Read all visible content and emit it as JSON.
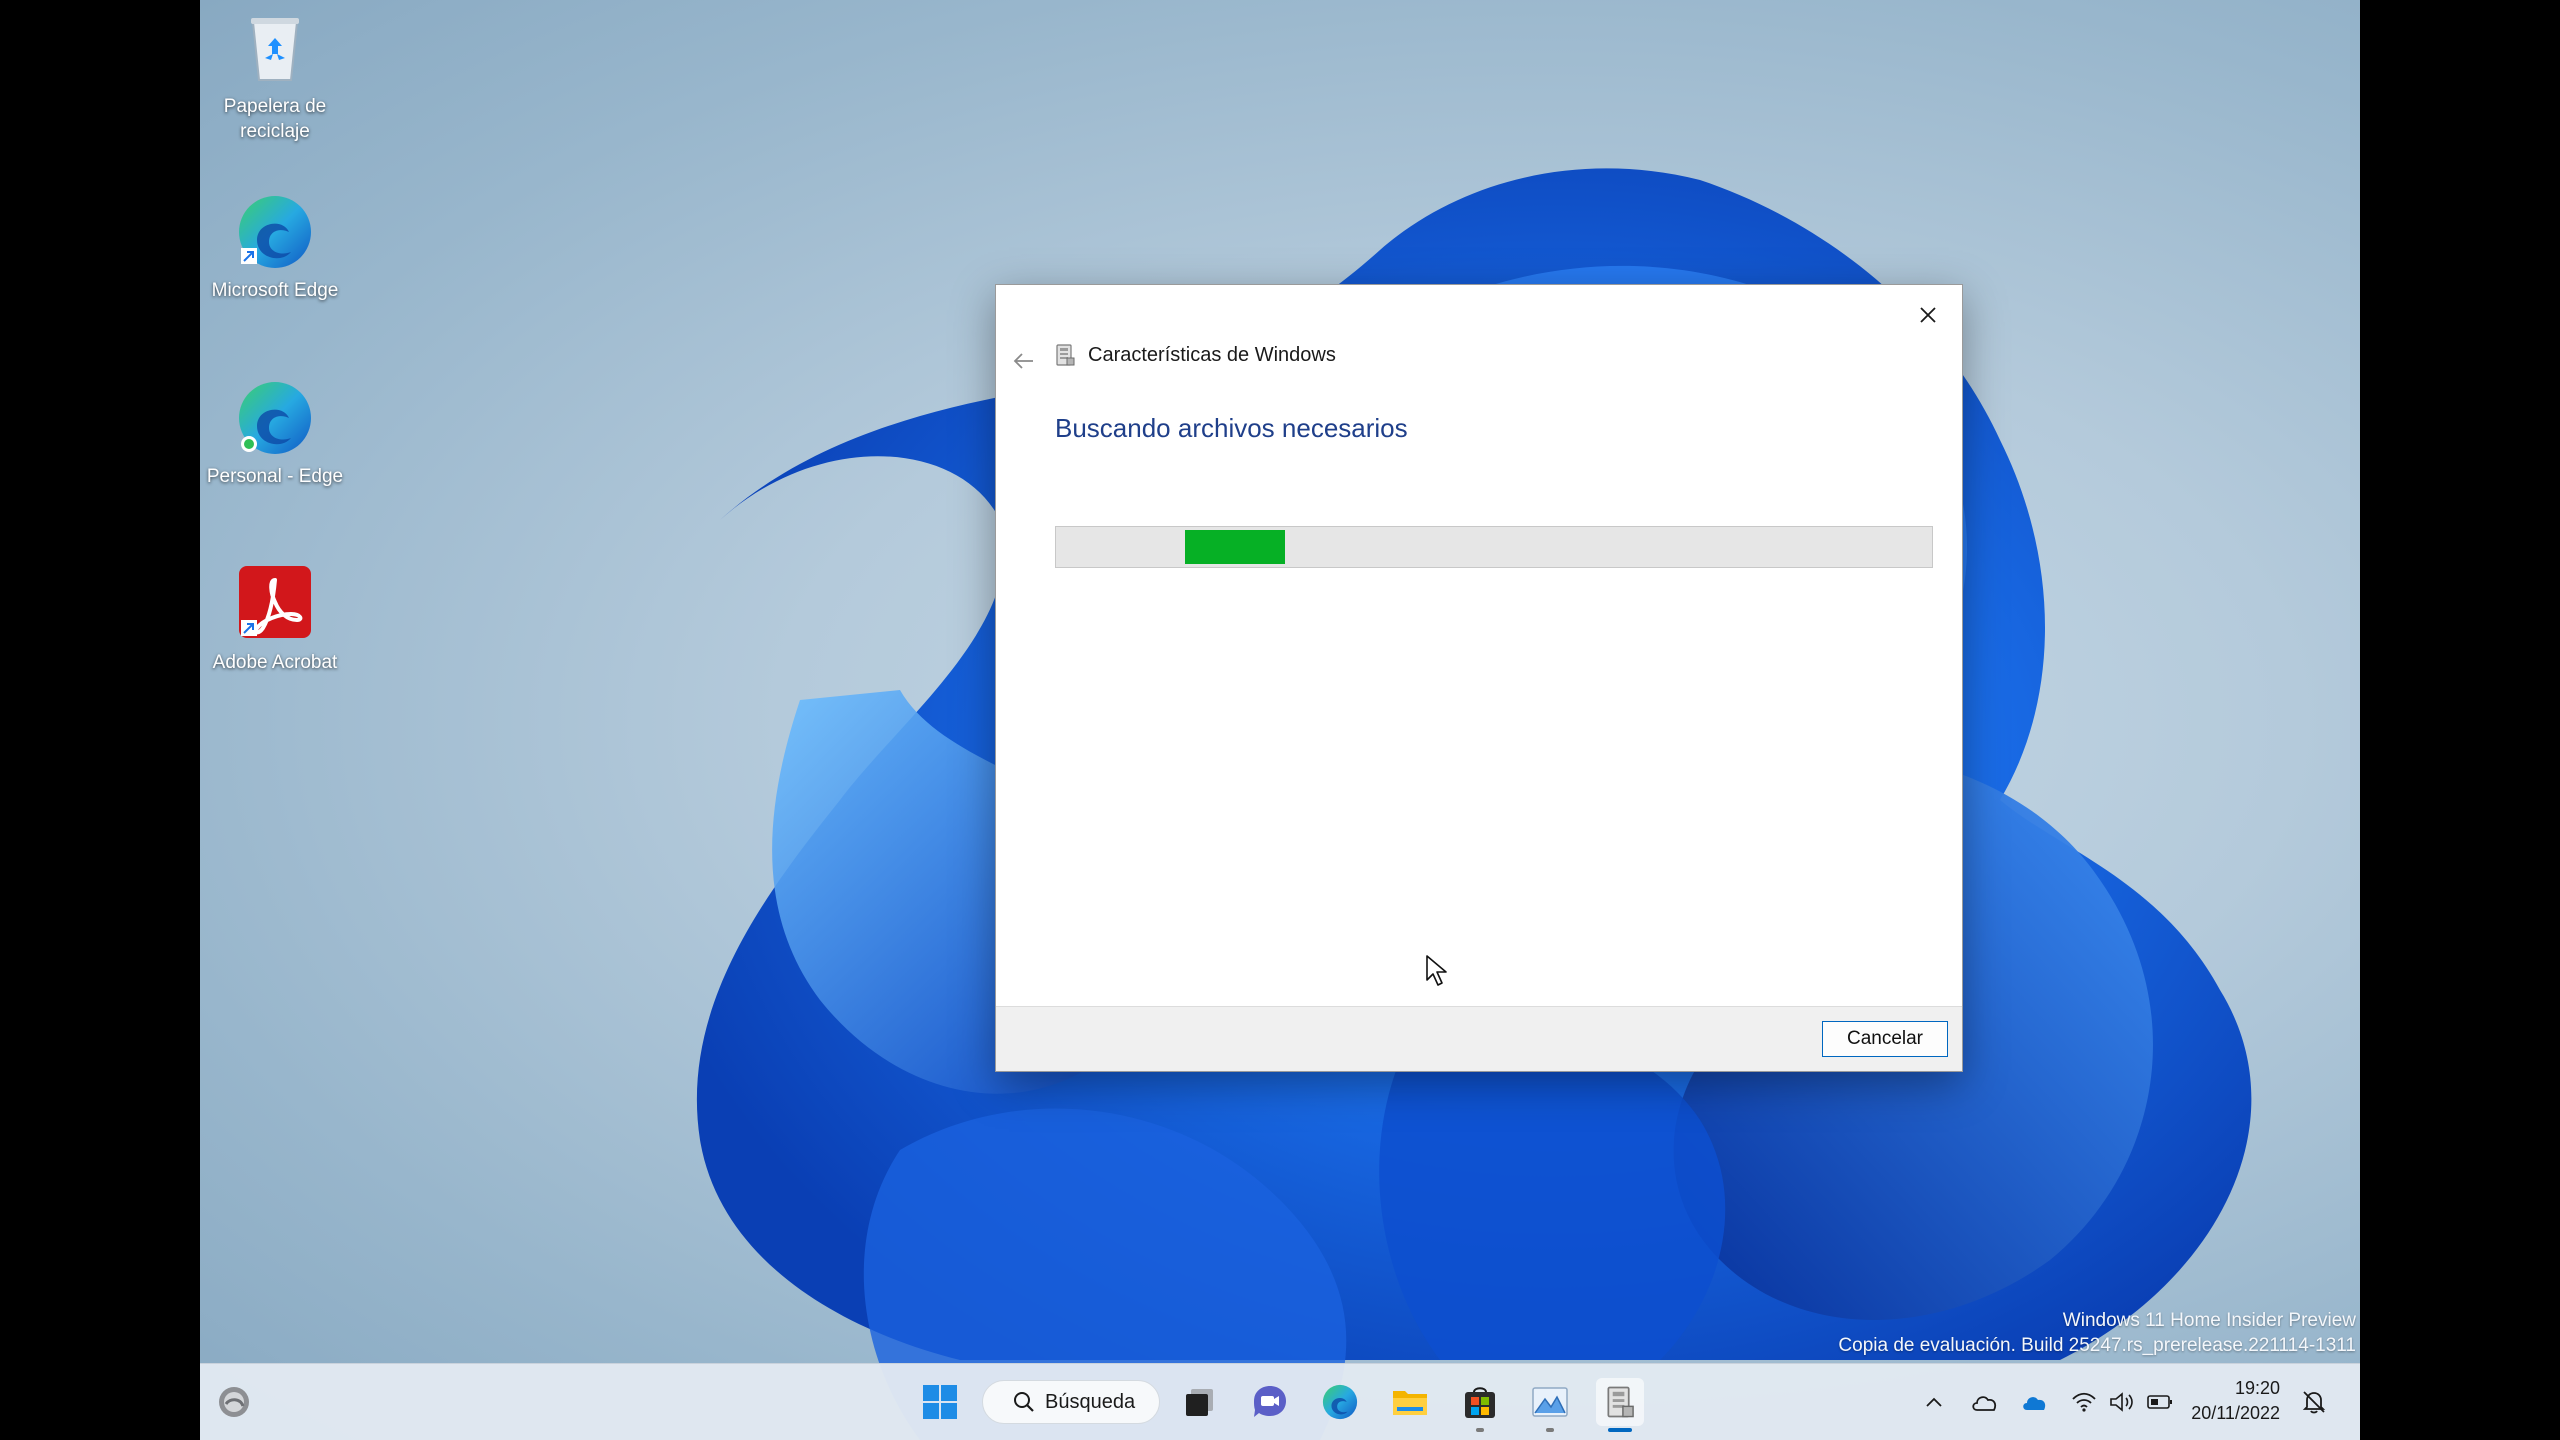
{
  "desktop": {
    "icons": [
      {
        "name": "recycle-bin",
        "label": "Papelera de reciclaje"
      },
      {
        "name": "microsoft-edge",
        "label": "Microsoft Edge"
      },
      {
        "name": "personal-edge",
        "label": "Personal - Edge"
      },
      {
        "name": "adobe-acrobat",
        "label": "Adobe Acrobat"
      }
    ]
  },
  "dialog": {
    "title": "Características de Windows",
    "heading": "Buscando archivos necesarios",
    "progress_fraction": 0.115,
    "progress_offset_fraction": 0.145,
    "cancel_label": "Cancelar",
    "progress_color": "#06b025"
  },
  "watermark": {
    "line1": "Windows 11 Home Insider Preview",
    "line2": "Copia de evaluación. Build 25247.rs_prerelease.221114-1311"
  },
  "taskbar": {
    "search_label": "Búsqueda",
    "apps": [
      "start-icon",
      "search",
      "task-view-icon",
      "chat-icon",
      "edge-icon",
      "file-explorer-icon",
      "store-icon",
      "photos-icon",
      "windows-features-icon"
    ],
    "time": "19:20",
    "date": "20/11/2022"
  },
  "colors": {
    "accent": "#0067c0",
    "heading": "#1f3f8a"
  }
}
